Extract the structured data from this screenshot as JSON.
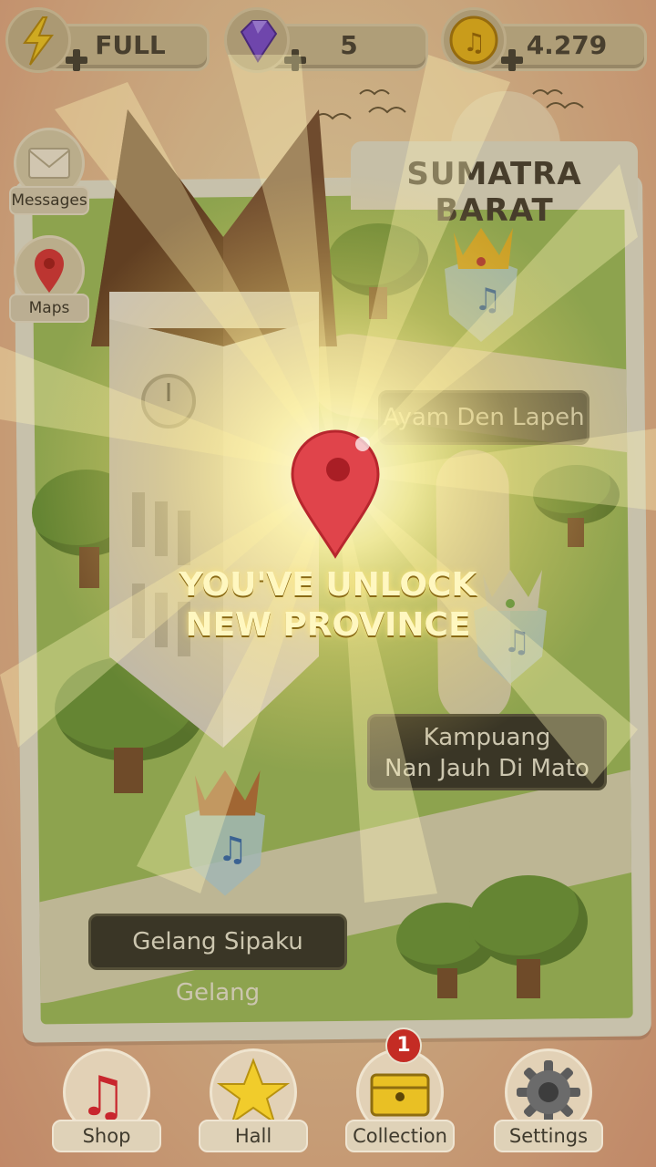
{
  "resources": {
    "energy": {
      "value": "FULL",
      "icon": "lightning-icon"
    },
    "gems": {
      "value": "5",
      "icon": "gem-icon"
    },
    "coins": {
      "value": "4.279",
      "icon": "music-coin-icon"
    }
  },
  "side_menu": [
    {
      "label": "Messages",
      "icon": "envelope-icon"
    },
    {
      "label": "Maps",
      "icon": "map-pin-icon"
    }
  ],
  "map": {
    "province_title": "SUMATRA BARAT",
    "songs": [
      {
        "title": "Ayam Den Lapeh",
        "crown": "gold"
      },
      {
        "title_line1": "Kampuang",
        "title_line2": "Nan Jauh Di Mato",
        "crown": "silver"
      },
      {
        "title": "Gelang Sipaku Gelang",
        "crown": "bronze"
      }
    ]
  },
  "popup": {
    "line1": "YOU'VE UNLOCK",
    "line2": "NEW PROVINCE"
  },
  "bottom_nav": [
    {
      "label": "Shop",
      "icon": "music-note-icon"
    },
    {
      "label": "Hall",
      "icon": "star-icon"
    },
    {
      "label": "Collection",
      "icon": "chest-icon",
      "badge": "1"
    },
    {
      "label": "Settings",
      "icon": "gear-icon"
    }
  ],
  "colors": {
    "accent": "#d9342e",
    "gold": "#f3c623",
    "glow": "#fff3a0"
  }
}
